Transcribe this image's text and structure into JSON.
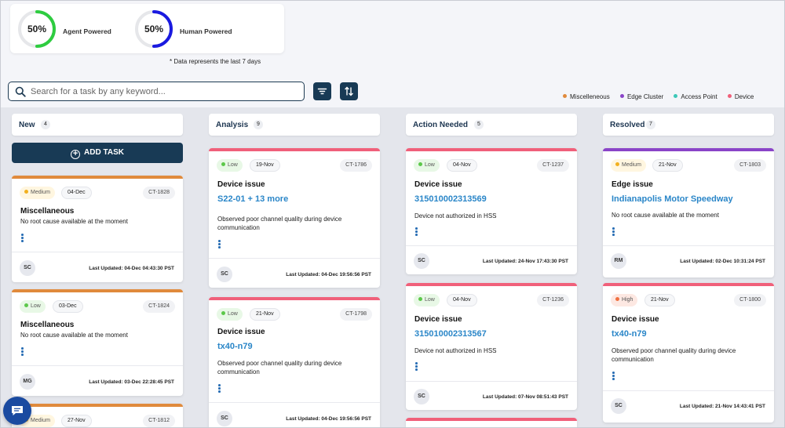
{
  "stats": {
    "agent": {
      "percent": "50%",
      "label": "Agent Powered",
      "color": "#2ecc40"
    },
    "human": {
      "percent": "50%",
      "label": "Human Powered",
      "color": "#1a1ae0"
    },
    "footnote": "* Data represents the last 7 days"
  },
  "search": {
    "placeholder": "Search for a task by any keyword..."
  },
  "legend": [
    {
      "label": "Miscelleneous",
      "color": "#e08a3c"
    },
    {
      "label": "Edge Cluster",
      "color": "#8a44c8"
    },
    {
      "label": "Access Point",
      "color": "#3cc8b8"
    },
    {
      "label": "Device",
      "color": "#f0607a"
    }
  ],
  "add_task": "ADD TASK",
  "columns": [
    {
      "title": "New",
      "count": "4",
      "cards": [
        {
          "priority": "Medium",
          "date": "04-Dec",
          "id": "CT-1828",
          "title": "Miscellaneous",
          "link": "",
          "desc": "No root cause available at the moment",
          "avatar": "SC",
          "updated": "Last Updated: 04-Dec 04:43:30 PST"
        },
        {
          "priority": "Low",
          "date": "03-Dec",
          "id": "CT-1824",
          "title": "Miscellaneous",
          "link": "",
          "desc": "No root cause available at the moment",
          "avatar": "MG",
          "updated": "Last Updated: 03-Dec 22:28:45 PST"
        },
        {
          "priority": "Medium",
          "date": "27-Nov",
          "id": "CT-1812",
          "title": "",
          "link": "",
          "desc": "",
          "avatar": "",
          "updated": ""
        }
      ]
    },
    {
      "title": "Analysis",
      "count": "9",
      "cards": [
        {
          "priority": "Low",
          "date": "19-Nov",
          "id": "CT-1786",
          "title": "Device issue",
          "link": "S22-01 + 13 more",
          "desc": "Observed poor channel quality during device communication",
          "avatar": "SC",
          "updated": "Last Updated: 04-Dec 19:56:56 PST"
        },
        {
          "priority": "Low",
          "date": "21-Nov",
          "id": "CT-1798",
          "title": "Device issue",
          "link": "tx40-n79",
          "desc": "Observed poor channel quality during device communication",
          "avatar": "SC",
          "updated": "Last Updated: 04-Dec 19:56:56 PST"
        }
      ]
    },
    {
      "title": "Action Needed",
      "count": "5",
      "cards": [
        {
          "priority": "Low",
          "date": "04-Nov",
          "id": "CT-1237",
          "title": "Device issue",
          "link": "315010002313569",
          "desc": "Device not authorized in HSS",
          "avatar": "SC",
          "updated": "Last Updated: 24-Nov 17:43:30 PST"
        },
        {
          "priority": "Low",
          "date": "04-Nov",
          "id": "CT-1236",
          "title": "Device issue",
          "link": "315010002313567",
          "desc": "Device not authorized in HSS",
          "avatar": "SC",
          "updated": "Last Updated: 07-Nov 08:51:43 PST"
        }
      ]
    },
    {
      "title": "Resolved",
      "count": "7",
      "cards": [
        {
          "priority": "Medium",
          "date": "21-Nov",
          "id": "CT-1803",
          "title": "Edge issue",
          "link": "Indianapolis Motor Speedway",
          "desc": "No root cause available at the moment",
          "avatar": "RM",
          "updated": "Last Updated: 02-Dec 10:31:24 PST"
        },
        {
          "priority": "High",
          "date": "21-Nov",
          "id": "CT-1800",
          "title": "Device issue",
          "link": "tx40-n79",
          "desc": "Observed poor channel quality during device communication",
          "avatar": "SC",
          "updated": "Last Updated: 21-Nov 14:43:41 PST"
        }
      ]
    }
  ]
}
